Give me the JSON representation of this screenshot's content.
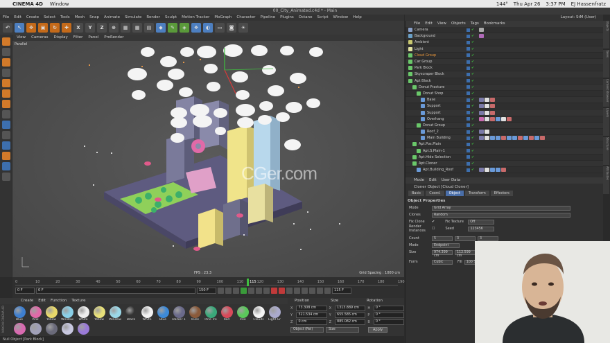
{
  "mac": {
    "app": "CINEMA 4D",
    "menu": "Window",
    "wifi": "",
    "battery": "144°",
    "date": "Thu Apr 26",
    "time": "3:37 PM",
    "user": "EJ Hassenfratz"
  },
  "window": {
    "title": "00_City_Animated.c4d * - Main",
    "layout_label": "Layout:",
    "layout_value": "StM (User)"
  },
  "menubar": [
    "File",
    "Edit",
    "Create",
    "Select",
    "Tools",
    "Mesh",
    "Snap",
    "Animate",
    "Simulate",
    "Render",
    "Sculpt",
    "Motion Tracker",
    "MoGraph",
    "Character",
    "Pipeline",
    "Plugins",
    "Octane",
    "Script",
    "Window",
    "Help"
  ],
  "toolbar": {
    "undo": "↶",
    "x": "X",
    "y": "Y",
    "z": "Z"
  },
  "viewport": {
    "menu": [
      "View",
      "Cameras",
      "Display",
      "Filter",
      "Panel",
      "ProRender"
    ],
    "label": "Parallel",
    "fps": "FPS : 23.3",
    "grid": "Grid Spacing : 1000 cm",
    "watermark": "CGer.com"
  },
  "timeline": {
    "ticks": [
      "0",
      "10",
      "20",
      "30",
      "40",
      "50",
      "60",
      "70",
      "80",
      "90",
      "100",
      "110",
      "120",
      "130",
      "140",
      "150",
      "160",
      "170",
      "180",
      "190"
    ],
    "current": "115",
    "start": "0 F",
    "start2": "0 F",
    "end": "150 F",
    "end2": "115 F"
  },
  "materials": {
    "menu": [
      "Create",
      "Edit",
      "Function",
      "Texture"
    ],
    "items": [
      {
        "name": "Blue",
        "color": "#3e7fd0"
      },
      {
        "name": "Pink",
        "color": "#e06aa8"
      },
      {
        "name": "Yellow",
        "color": "#e8d86a"
      },
      {
        "name": "Window",
        "color": "#8ad0e8"
      },
      {
        "name": "White",
        "color": "#eeeeee"
      },
      {
        "name": "Yellow",
        "color": "#e8e07a"
      },
      {
        "name": "Window",
        "color": "#9bd8e8"
      },
      {
        "name": "Black",
        "color": "#333333"
      },
      {
        "name": "White",
        "color": "#f2f2f2"
      },
      {
        "name": "Blue",
        "color": "#3d8ad8"
      },
      {
        "name": "Darker 1",
        "color": "#6a6a8a"
      },
      {
        "name": "Trunk",
        "color": "#8a5a3a"
      },
      {
        "name": "Pine Tre",
        "color": "#3aa87a"
      },
      {
        "name": "Red",
        "color": "#d84a5a"
      },
      {
        "name": "Tree",
        "color": "#5ac85a"
      },
      {
        "name": "Clouds",
        "color": "#f4f4f4"
      },
      {
        "name": "Light Gr",
        "color": "#aaaacc"
      },
      {
        "name": "",
        "color": "#d86ab0"
      },
      {
        "name": "",
        "color": "#a0a0b8"
      },
      {
        "name": "",
        "color": "#6a6a7a"
      },
      {
        "name": "",
        "color": "#c8c8e0"
      },
      {
        "name": "",
        "color": "#9a7ad8"
      }
    ]
  },
  "maxon": "MAXON CINEMA 4D",
  "coords": {
    "headers": [
      "Position",
      "Size",
      "Rotation"
    ],
    "rows": [
      {
        "axis": "X",
        "pos": "73.308 cm",
        "size": "1313.889 cm",
        "rlab": "H",
        "rot": "0 °"
      },
      {
        "axis": "Y",
        "pos": "521.534 cm",
        "size": "655.585 cm",
        "rlab": "P",
        "rot": "0 °"
      },
      {
        "axis": "Z",
        "pos": "0 cm",
        "size": "885.082 cm",
        "rlab": "B",
        "rot": "0 °"
      }
    ],
    "sel1": "Object (Rel)",
    "sel2": "Size",
    "apply": "Apply"
  },
  "status": "Null Object [Park Block]",
  "objects": {
    "menu": [
      "File",
      "Edit",
      "View",
      "Objects",
      "Tags",
      "Bookmarks"
    ],
    "rows": [
      {
        "name": "Camera",
        "indent": 0,
        "icon": "#8aa0c8",
        "tags": [
          "#aaa"
        ]
      },
      {
        "name": "Background",
        "indent": 0,
        "icon": "#6aa0c8",
        "tags": [
          "#b06ab8"
        ]
      },
      {
        "name": "Ambient",
        "indent": 0,
        "icon": "#c8c870",
        "tags": []
      },
      {
        "name": "Light",
        "indent": 0,
        "icon": "#e0e0a0",
        "tags": []
      },
      {
        "name": "Cloud Group",
        "indent": 0,
        "icon": "#6ac86a",
        "tags": [],
        "orange": true
      },
      {
        "name": "Car Group",
        "indent": 0,
        "icon": "#6ac86a",
        "tags": []
      },
      {
        "name": "Park Block",
        "indent": 0,
        "icon": "#6ac86a",
        "tags": []
      },
      {
        "name": "Skyscraper Block",
        "indent": 0,
        "icon": "#6ac86a",
        "tags": []
      },
      {
        "name": "Apt Block",
        "indent": 0,
        "icon": "#6ac86a",
        "tags": []
      },
      {
        "name": "Donut Fracture",
        "indent": 1,
        "icon": "#6ac86a",
        "tags": []
      },
      {
        "name": "Donut Shop",
        "indent": 2,
        "icon": "#6ac86a",
        "tags": []
      },
      {
        "name": "Base",
        "indent": 3,
        "icon": "#6a9ad8",
        "tags": [
          "#7a7aa8",
          "#e0e0e0",
          "#c86a6a"
        ]
      },
      {
        "name": "Support",
        "indent": 3,
        "icon": "#6a9ad8",
        "tags": [
          "#7a7aa8",
          "#e0e0e0",
          "#c86a6a"
        ]
      },
      {
        "name": "Support",
        "indent": 3,
        "icon": "#6a9ad8",
        "tags": [
          "#7a7aa8",
          "#e0e0e0",
          "#c86a6a"
        ]
      },
      {
        "name": "Overhang",
        "indent": 3,
        "icon": "#6a9ad8",
        "tags": [
          "#c86ab0",
          "#e0e0e0",
          "#c86a6a",
          "#6a9ad8",
          "#e0e0e0",
          "#c86a6a"
        ]
      },
      {
        "name": "Donut Group",
        "indent": 2,
        "icon": "#6ac86a",
        "tags": []
      },
      {
        "name": "Roof_2",
        "indent": 3,
        "icon": "#6a9ad8",
        "tags": [
          "#7a7aa8",
          "#e0e0e0"
        ]
      },
      {
        "name": "Main Building",
        "indent": 3,
        "icon": "#6a9ad8",
        "tags": [
          "#7a7aa8",
          "#e0e0e0",
          "#6a9ad8",
          "#6a9ad8",
          "#c86a6a",
          "#6a9ad8",
          "#6a9ad8",
          "#c86a6a",
          "#6a9ad8",
          "#c86a6a",
          "#6a9ad8",
          "#c86a6a"
        ]
      },
      {
        "name": "Apt.Pos.Plain",
        "indent": 1,
        "icon": "#6ac86a",
        "tags": []
      },
      {
        "name": "Apt.S.Plain-1",
        "indent": 2,
        "icon": "#6ac86a",
        "tags": []
      },
      {
        "name": "Apt.Hide Selection",
        "indent": 1,
        "icon": "#6ac86a",
        "tags": []
      },
      {
        "name": "Apt.Cloner",
        "indent": 1,
        "icon": "#6ac86a",
        "tags": []
      },
      {
        "name": "Apt.Building_Roof",
        "indent": 2,
        "icon": "#6a9ad8",
        "tags": [
          "#7a7aa8",
          "#e0e0e0",
          "#6a9ad8",
          "#6a9ad8",
          "#c86a6a"
        ]
      }
    ]
  },
  "attributes": {
    "menu": [
      "Mode",
      "Edit",
      "User Data"
    ],
    "title": "Cloner Object [Cloud Cloner]",
    "tabs": [
      "Basic",
      "Coord.",
      "Object",
      "Transform",
      "Effectors"
    ],
    "active_tab": "Object",
    "header": "Object Properties",
    "mode_label": "Mode",
    "mode_value": "Grid Array",
    "clones_label": "Clones",
    "clones_value": "Random",
    "fixclone_label": "Fix Clone",
    "fixtex_label": "Fix Texture",
    "fixtex_value": "Off",
    "render_label": "Render Instances",
    "seed_label": "Seed",
    "seed_value": "123456",
    "count_label": "Count",
    "count_values": [
      "5",
      "3",
      "3"
    ],
    "mode2_label": "Mode",
    "mode2_value": "Endpoint",
    "size_label": "Size",
    "size_values": [
      "974.399 cm",
      "112.599 cm",
      "1200 cm"
    ],
    "form_label": "Form",
    "form_value": "Cubic",
    "fill_label": "Fill",
    "fill_value": "100 %"
  },
  "sidetabs": [
    "Objects",
    "Takes",
    "Content Browser",
    "Layers",
    "Structure",
    "Attributes"
  ]
}
